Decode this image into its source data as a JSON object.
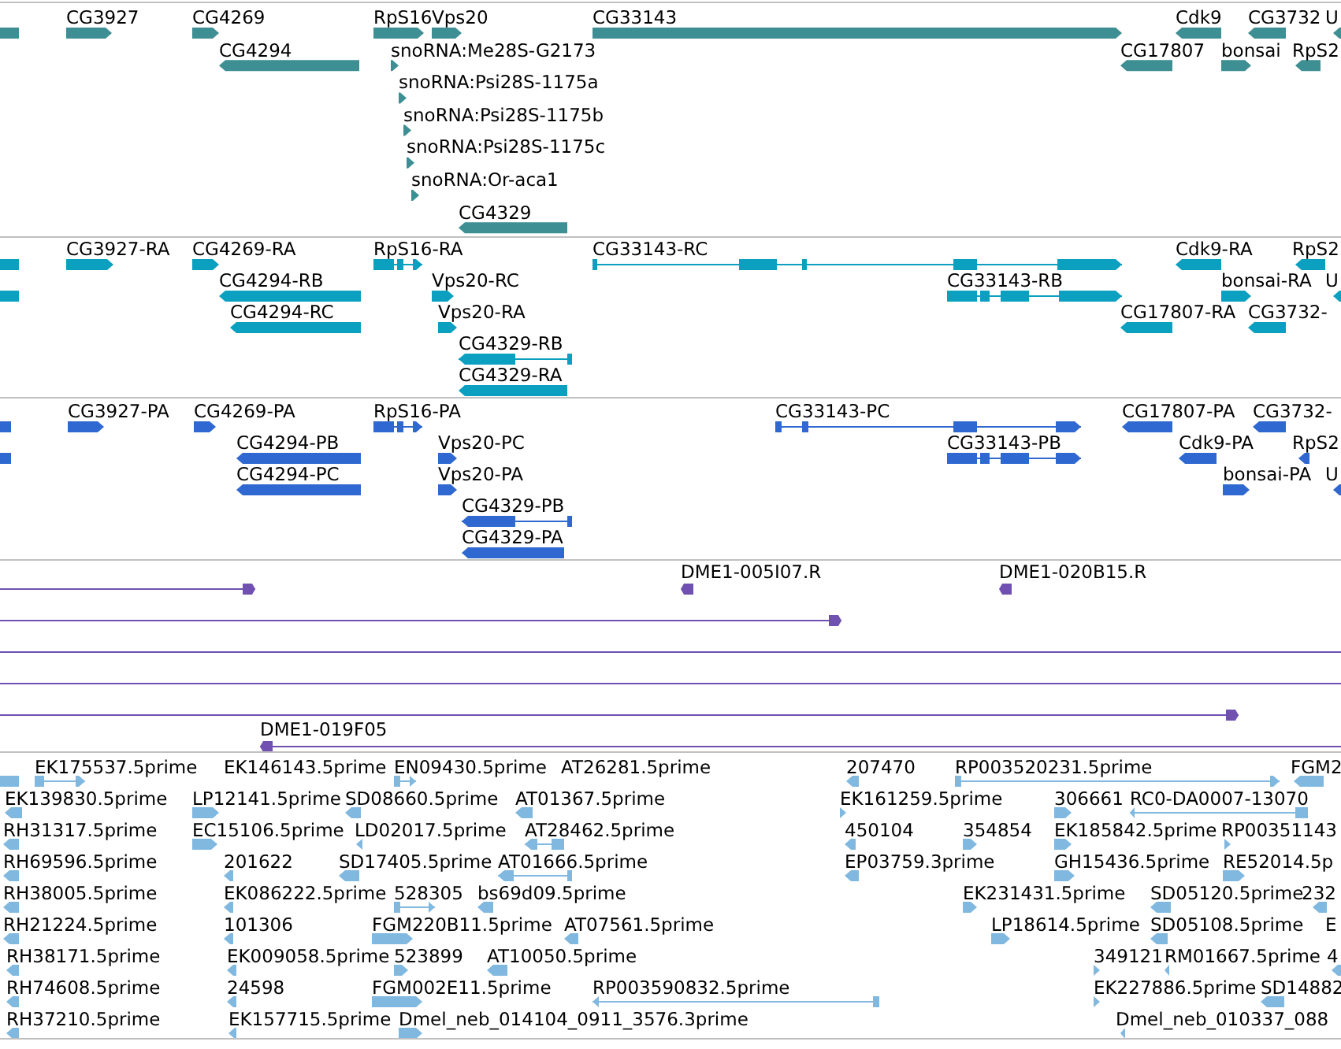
{
  "tracks": [
    {
      "features": [
        {
          "reverse": true
        },
        {
          "label": "CG3927",
          "reverse": false
        },
        {
          "label": "CG4269",
          "reverse": false
        },
        {
          "label": "RpS16",
          "reverse": false
        },
        {
          "label": "Vps20",
          "reverse": false
        },
        {
          "label": "CG33143",
          "reverse": false
        },
        {
          "label": "Cdk9",
          "reverse": true
        },
        {
          "label": "CG3732",
          "reverse": true
        },
        {
          "label": "U",
          "reverse": true
        },
        {
          "label": "CG4294",
          "reverse": true
        },
        {
          "label": "snoRNA:Me28S-G2173",
          "reverse": false
        },
        {
          "label": "CG17807",
          "reverse": true
        },
        {
          "label": "bonsai",
          "reverse": false
        },
        {
          "label": "RpS2",
          "reverse": true
        },
        {
          "label": "snoRNA:Psi28S-1175a",
          "reverse": false
        },
        {
          "label": "snoRNA:Psi28S-1175b",
          "reverse": false
        },
        {
          "label": "snoRNA:Psi28S-1175c",
          "reverse": false
        },
        {
          "label": "snoRNA:Or-aca1",
          "reverse": false
        },
        {
          "label": "CG4329",
          "reverse": true
        }
      ]
    },
    {
      "features": [
        {
          "reverse": true
        },
        {
          "label": "CG3927-RA",
          "reverse": false
        },
        {
          "label": "CG4269-RA",
          "reverse": false
        },
        {
          "label": "RpS16-RA",
          "reverse": false
        },
        {
          "label": "CG33143-RC",
          "reverse": false
        },
        {
          "label": "Cdk9-RA",
          "reverse": true
        },
        {
          "label": "RpS2",
          "reverse": true
        },
        {
          "reverse": true
        },
        {
          "label": "CG4294-RB",
          "reverse": true
        },
        {
          "label": "Vps20-RC",
          "reverse": false
        },
        {
          "label": "CG33143-RB",
          "reverse": false
        },
        {
          "label": "bonsai-RA",
          "reverse": false
        },
        {
          "label": "U",
          "reverse": true
        },
        {
          "label": "CG4294-RC",
          "reverse": true
        },
        {
          "label": "Vps20-RA",
          "reverse": false
        },
        {
          "label": "CG17807-RA",
          "reverse": true
        },
        {
          "label": "CG3732-",
          "reverse": true
        },
        {
          "label": "CG4329-RB",
          "reverse": true
        },
        {
          "label": "CG4329-RA",
          "reverse": true
        }
      ]
    },
    {
      "features": [
        {
          "reverse": true
        },
        {
          "label": "CG3927-PA",
          "reverse": false
        },
        {
          "label": "CG4269-PA",
          "reverse": false
        },
        {
          "label": "RpS16-PA",
          "reverse": false
        },
        {
          "label": "CG33143-PC",
          "reverse": false
        },
        {
          "label": "CG17807-PA",
          "reverse": true
        },
        {
          "label": "CG3732-",
          "reverse": true
        },
        {
          "reverse": true
        },
        {
          "label": "CG4294-PB",
          "reverse": true
        },
        {
          "label": "Vps20-PC",
          "reverse": false
        },
        {
          "label": "CG33143-PB",
          "reverse": false
        },
        {
          "label": "Cdk9-PA",
          "reverse": true
        },
        {
          "label": "RpS2",
          "reverse": true
        },
        {
          "label": "CG4294-PC",
          "reverse": true
        },
        {
          "label": "Vps20-PA",
          "reverse": false
        },
        {
          "label": "bonsai-PA",
          "reverse": false
        },
        {
          "label": "U",
          "reverse": true
        },
        {
          "label": "CG4329-PB",
          "reverse": true
        },
        {
          "label": "CG4329-PA",
          "reverse": true
        }
      ]
    },
    {
      "features": [
        {
          "reverse": false
        },
        {
          "label": "DME1-005I07.R",
          "reverse": true
        },
        {
          "label": "DME1-020B15.R",
          "reverse": true
        },
        {
          "reverse": false
        },
        {
          "reverse": true
        },
        {
          "reverse": true
        },
        {
          "reverse": false
        },
        {
          "label": "DME1-019F05",
          "reverse": true
        }
      ]
    },
    {
      "features": [
        {
          "reverse": true
        },
        {
          "label": "EK175537.5prime",
          "reverse": false
        },
        {
          "label": "EK146143.5prime"
        },
        {
          "label": "EN09430.5prime",
          "reverse": false
        },
        {
          "label": "AT26281.5prime"
        },
        {
          "label": "207470",
          "reverse": true
        },
        {
          "label": "RP003520231.5prime",
          "reverse": false
        },
        {
          "label": "FGM2",
          "reverse": true
        },
        {
          "label": "EK139830.5prime",
          "reverse": true
        },
        {
          "label": "LP12141.5prime",
          "reverse": false
        },
        {
          "label": "SD08660.5prime",
          "reverse": true
        },
        {
          "label": "AT01367.5prime",
          "reverse": true
        },
        {
          "label": "EK161259.5prime",
          "reverse": false
        },
        {
          "label": "306661",
          "reverse": false
        },
        {
          "label": "RC0-DA0007-13070",
          "reverse": true
        },
        {
          "label": "RH31317.5prime",
          "reverse": true
        },
        {
          "label": "EC15106.5prime",
          "reverse": false
        },
        {
          "label": "LD02017.5prime",
          "reverse": true
        },
        {
          "label": "AT28462.5prime",
          "reverse": true
        },
        {
          "label": "450104",
          "reverse": true
        },
        {
          "label": "354854",
          "reverse": false
        },
        {
          "label": "EK185842.5prime",
          "reverse": false
        },
        {
          "label": "RP00351143",
          "reverse": false
        },
        {
          "label": "RH69596.5prime",
          "reverse": true
        },
        {
          "label": "201622",
          "reverse": true
        },
        {
          "label": "SD17405.5prime",
          "reverse": true
        },
        {
          "label": "AT01666.5prime",
          "reverse": true
        },
        {
          "label": "EP03759.3prime",
          "reverse": true
        },
        {
          "label": "GH15436.5prime",
          "reverse": false
        },
        {
          "label": "RE52014.5p",
          "reverse": false
        },
        {
          "label": "RH38005.5prime",
          "reverse": true
        },
        {
          "label": "EK086222.5prime",
          "reverse": true
        },
        {
          "label": "528305",
          "reverse": false
        },
        {
          "label": "bs69d09.5prime",
          "reverse": true
        },
        {
          "label": "EK231431.5prime",
          "reverse": false
        },
        {
          "label": "SD05120.5prime",
          "reverse": true
        },
        {
          "label": "232",
          "reverse": true
        },
        {
          "label": "RH21224.5prime",
          "reverse": true
        },
        {
          "label": "101306",
          "reverse": true
        },
        {
          "label": "FGM220B11.5prime",
          "reverse": false
        },
        {
          "label": "AT07561.5prime",
          "reverse": true
        },
        {
          "label": "LP18614.5prime",
          "reverse": false
        },
        {
          "label": "SD05108.5prime",
          "reverse": true
        },
        {
          "label": "E"
        },
        {
          "label": "RH38171.5prime",
          "reverse": true
        },
        {
          "label": "EK009058.5prime",
          "reverse": true
        },
        {
          "label": "523899",
          "reverse": false
        },
        {
          "label": "AT10050.5prime",
          "reverse": true
        },
        {
          "label": "349121",
          "reverse": false
        },
        {
          "label": "RM01667.5prime",
          "reverse": true
        },
        {
          "label": "4",
          "reverse": true
        },
        {
          "label": "RH74608.5prime",
          "reverse": true
        },
        {
          "label": "24598",
          "reverse": true
        },
        {
          "label": "FGM002E11.5prime",
          "reverse": false
        },
        {
          "label": "RP003590832.5prime",
          "reverse": true
        },
        {
          "label": "EK227886.5prime",
          "reverse": false
        },
        {
          "label": "SD14882",
          "reverse": true
        },
        {
          "label": "RH37210.5prime",
          "reverse": true
        },
        {
          "label": "EK157715.5prime",
          "reverse": true
        },
        {
          "label": "Dmel_neb_014104_0911_3576.3prime",
          "reverse": false
        },
        {
          "label": "Dmel_neb_010337_088",
          "reverse": true
        }
      ]
    }
  ]
}
